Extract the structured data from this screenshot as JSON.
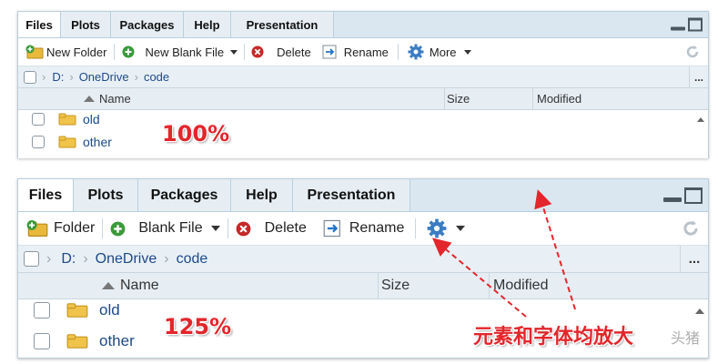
{
  "panel100": {
    "tabs": [
      "Files",
      "Plots",
      "Packages",
      "Help",
      "Presentation"
    ],
    "toolbar": {
      "new_folder": "New Folder",
      "new_blank_file": "New Blank File",
      "delete": "Delete",
      "rename": "Rename",
      "more": "More"
    },
    "path": [
      "D:",
      "OneDrive",
      "code"
    ],
    "path_more": "...",
    "columns": {
      "name": "Name",
      "size": "Size",
      "modified": "Modified"
    },
    "files": [
      "old",
      "other"
    ],
    "zoom_label": "100%"
  },
  "panel125": {
    "tabs": [
      "Files",
      "Plots",
      "Packages",
      "Help",
      "Presentation"
    ],
    "toolbar": {
      "folder": "Folder",
      "blank_file": "Blank File",
      "delete": "Delete",
      "rename": "Rename"
    },
    "path": [
      "D:",
      "OneDrive",
      "code"
    ],
    "path_more": "...",
    "columns": {
      "name": "Name",
      "size": "Size",
      "modified": "Modified"
    },
    "files": [
      "old",
      "other"
    ],
    "zoom_label": "125%"
  },
  "annotation": "元素和字体均放大",
  "watermark": "头猪",
  "colors": {
    "accent_red": "#e3262b",
    "link_blue": "#1d4a88",
    "tab_bg": "#dbe7f0",
    "path_bg": "#e9f0f5"
  },
  "icons": [
    "new-folder-icon",
    "new-file-icon",
    "delete-icon",
    "rename-icon",
    "gear-icon",
    "refresh-icon",
    "folder-icon",
    "checkbox-icon"
  ]
}
